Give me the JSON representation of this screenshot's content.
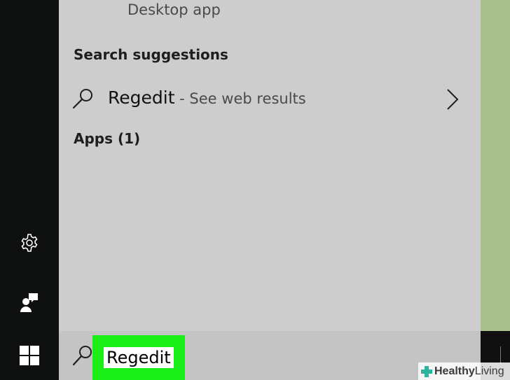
{
  "panel": {
    "desktop_app_label": "Desktop app",
    "suggestions_heading": "Search suggestions",
    "suggestion": {
      "term": "Regedit",
      "sub_text": " - See web results"
    },
    "apps_heading": "Apps (1)"
  },
  "search": {
    "value": "Regedit"
  },
  "rail": {
    "icons": [
      "settings-icon",
      "feedback-icon",
      "windows-start-icon"
    ]
  },
  "watermark": {
    "brand_bold": "Healthy",
    "brand_regular": " Living"
  },
  "colors": {
    "rail": "#0f1010",
    "panel": "#cdcdcd",
    "search_bar": "#c4c4c4",
    "highlight": "#19ee19",
    "desktop": "#a9bf8c"
  }
}
